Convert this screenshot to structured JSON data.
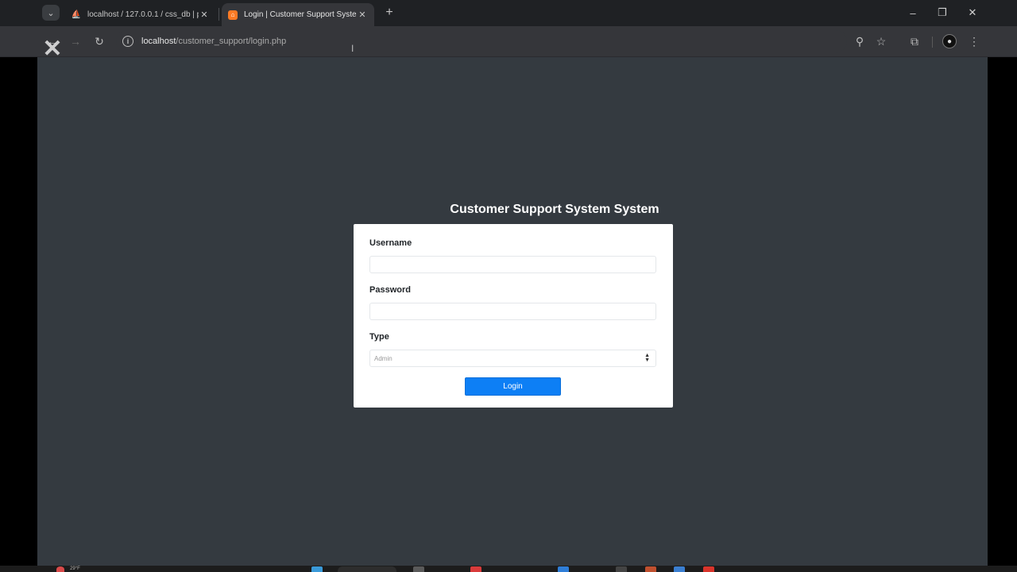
{
  "browser": {
    "tabs": [
      {
        "title": "localhost / 127.0.0.1 / css_db | p",
        "favicon": "phpmyadmin-icon",
        "active": false
      },
      {
        "title": "Login | Customer Support Syste",
        "favicon": "xampp-icon",
        "active": true
      }
    ],
    "new_tab_icon": "+",
    "address": {
      "host": "localhost",
      "path": "/customer_support/login.php"
    }
  },
  "page": {
    "heading": "Customer Support System System",
    "form": {
      "username_label": "Username",
      "username_value": "",
      "password_label": "Password",
      "password_value": "",
      "type_label": "Type",
      "type_selected": "Admin",
      "login_label": "Login"
    }
  },
  "taskbar": {
    "weather_text": "29°F"
  },
  "colors": {
    "page_bg": "#343a40",
    "card_bg": "#ffffff",
    "primary": "#0d7ff5"
  }
}
